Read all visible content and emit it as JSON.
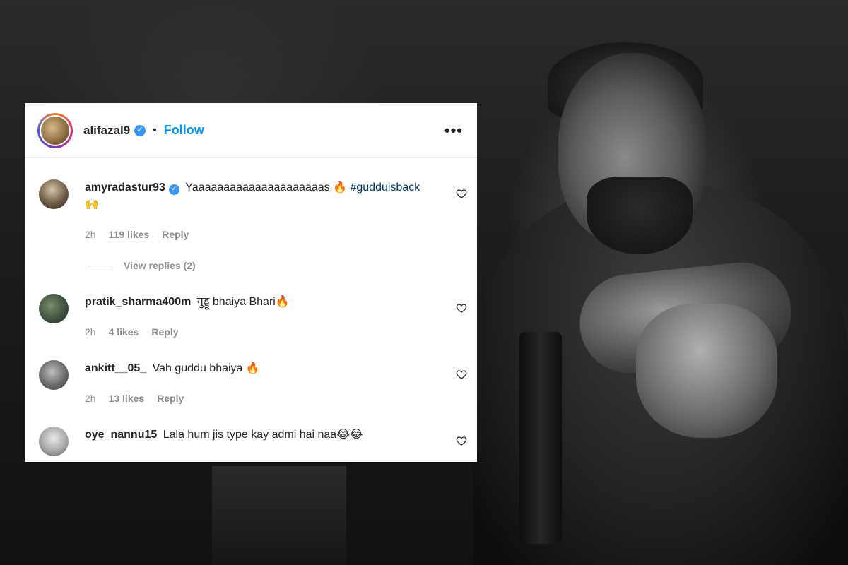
{
  "post": {
    "username": "alifazal9",
    "follow_label": "Follow",
    "separator": "•",
    "more_label": "•••"
  },
  "comments": [
    {
      "username": "amyradastur93",
      "verified": true,
      "text": "Yaaaaaaaaaaaaaaaaaaaaas 🔥",
      "hashtag": "#gudduisback",
      "text2": "🙌",
      "time": "2h",
      "likes": "119 likes",
      "reply": "Reply",
      "view_replies": "View replies (2)"
    },
    {
      "username": "pratik_sharma400m",
      "text": "गुड्डू bhaiya Bhari🔥",
      "time": "2h",
      "likes": "4 likes",
      "reply": "Reply"
    },
    {
      "username": "ankitt__05_",
      "text": "Vah guddu bhaiya 🔥",
      "time": "2h",
      "likes": "13 likes",
      "reply": "Reply"
    },
    {
      "username": "oye_nannu15",
      "text": "Lala hum jis type kay admi hai naa😂😂"
    }
  ]
}
